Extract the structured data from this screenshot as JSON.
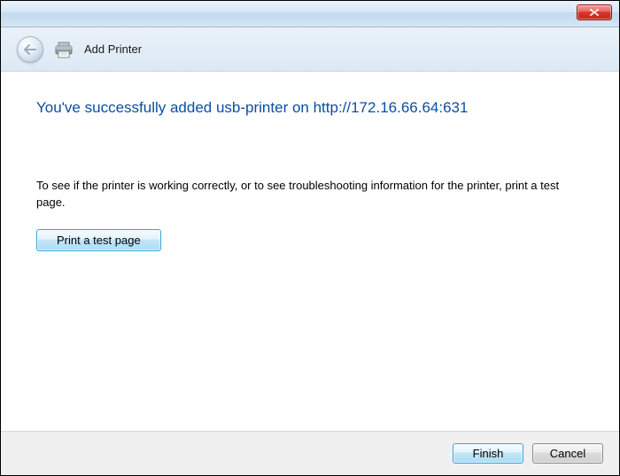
{
  "header": {
    "title": "Add Printer"
  },
  "main": {
    "success_heading": "You've successfully added usb-printer on http://172.16.66.64:631",
    "instruction": "To see if the printer is working correctly, or to see troubleshooting information for the printer, print a test page.",
    "test_button_label": "Print a test page"
  },
  "footer": {
    "finish_label": "Finish",
    "cancel_label": "Cancel"
  }
}
